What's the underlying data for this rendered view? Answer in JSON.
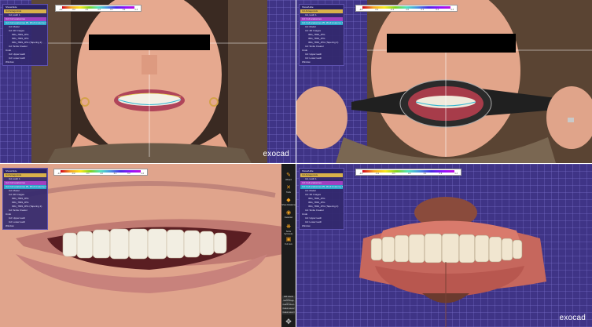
{
  "panes": [
    {
      "id": "p1",
      "name": "smile-photo-front",
      "brand": "exocad"
    },
    {
      "id": "p2",
      "name": "retractor-photo-front",
      "brand": ""
    },
    {
      "id": "p3",
      "name": "smile-closeup",
      "brand": ""
    },
    {
      "id": "p4",
      "name": "3d-dentition-model",
      "brand": "exocad"
    }
  ],
  "sidebar": {
    "rows": [
      "Show/Hide",
      "Ud Antagonists",
      "Ud, tooth 1",
      "Ud: Full anatomies",
      "Ud: Full anatomies #5, #Full Anatomy #6",
      "Ud: Pre/Post Anatomy/Preparation #7",
      "Ud: Model",
      "Ud: 2D Images",
      "IMG_7839_JPG",
      "IMG_7839_JPG",
      "IMG_7839_JPG (Tapering 2)",
      "Ud: Smile Creator",
      "Undo",
      "Ud: Upper teeth",
      "Ud: Lower teeth",
      "Window"
    ]
  },
  "scale": {
    "ticks": [
      "-0.3",
      "-0.2",
      "-0.1",
      "0.0",
      "0.1",
      "0.2",
      "0.3"
    ]
  },
  "toolbar": {
    "items": [
      "Wizard",
      "Tools",
      "Show Relations",
      "Facebow",
      "Smile Symmetry",
      "Cut view"
    ],
    "buttons": [
      "Edit Lateral View",
      "Smile Design View",
      "Custom view 1",
      "Custom view 2",
      "Custom view 3"
    ]
  }
}
